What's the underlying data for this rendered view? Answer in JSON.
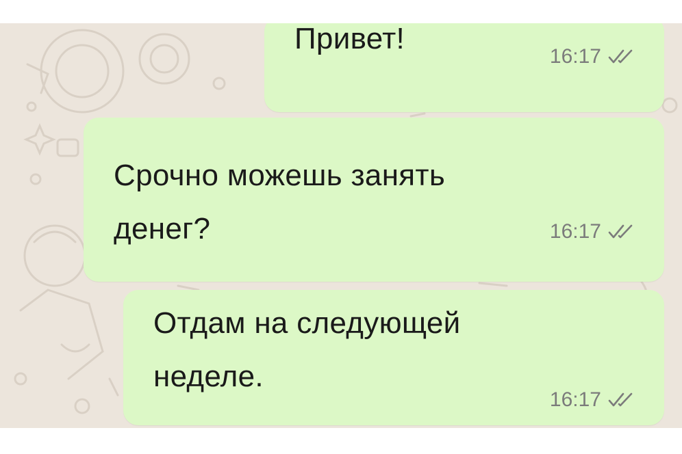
{
  "chat": {
    "messages": [
      {
        "text": "Привет!",
        "time": "16:17",
        "status_icon": "double-check-icon"
      },
      {
        "text": "Срочно можешь занять\nденег?",
        "time": "16:17",
        "status_icon": "double-check-icon"
      },
      {
        "text": "Отдам на следующей\nнеделе.",
        "time": "16:17",
        "status_icon": "double-check-icon"
      }
    ],
    "colors": {
      "outgoing_bubble": "#dcf8c6",
      "wallpaper": "#ece5dc",
      "text": "#1a1a1a",
      "meta": "#7b7b7b"
    }
  }
}
